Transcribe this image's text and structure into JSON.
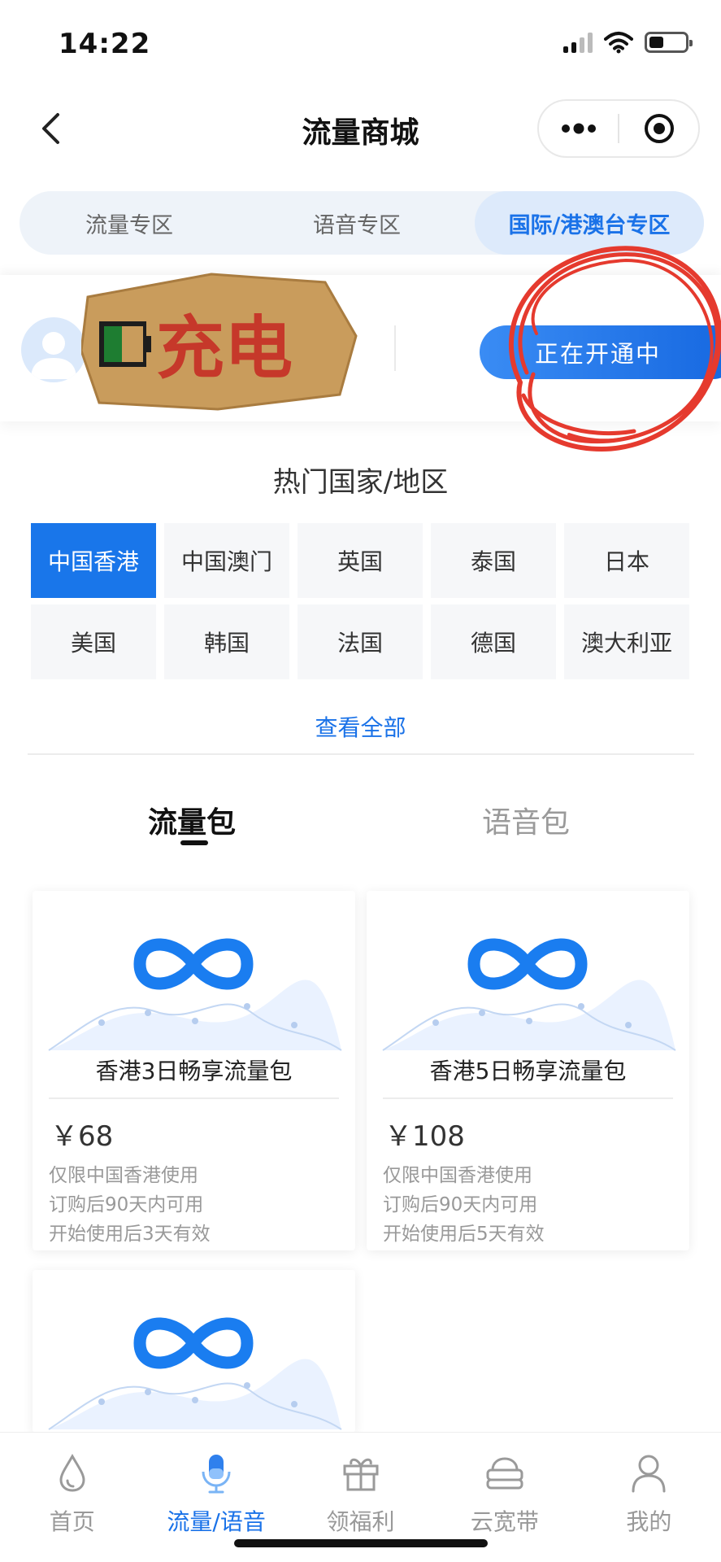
{
  "status_bar": {
    "time": "14:22"
  },
  "header": {
    "title": "流量商城"
  },
  "zone_tabs": [
    {
      "label": "流量专区",
      "active": false
    },
    {
      "label": "语音专区",
      "active": false
    },
    {
      "label": "国际/港澳台专区",
      "active": true
    }
  ],
  "user_card": {
    "sticker_text": "充电",
    "status_button": "正在开通中"
  },
  "hot_regions": {
    "title": "热门国家/地区",
    "items": [
      "中国香港",
      "中国澳门",
      "英国",
      "泰国",
      "日本",
      "美国",
      "韩国",
      "法国",
      "德国",
      "澳大利亚"
    ],
    "active_index": 0,
    "view_all": "查看全部"
  },
  "package_tabs": {
    "active": "流量包",
    "inactive": "语音包"
  },
  "products": [
    {
      "name": "香港3日畅享流量包",
      "price": "￥68",
      "desc": [
        "仅限中国香港使用",
        "订购后90天内可用",
        "开始使用后3天有效"
      ]
    },
    {
      "name": "香港5日畅享流量包",
      "price": "￥108",
      "desc": [
        "仅限中国香港使用",
        "订购后90天内可用",
        "开始使用后5天有效"
      ]
    }
  ],
  "bottom_nav": [
    {
      "label": "首页",
      "icon": "drop-icon",
      "active": false
    },
    {
      "label": "流量/语音",
      "icon": "microphone-icon",
      "active": true
    },
    {
      "label": "领福利",
      "icon": "gift-icon",
      "active": false
    },
    {
      "label": "云宽带",
      "icon": "router-icon",
      "active": false
    },
    {
      "label": "我的",
      "icon": "user-icon",
      "active": false
    }
  ],
  "colors": {
    "accent": "#1a72e8",
    "active_region": "#1976ea",
    "scribble": "#e53a2e"
  }
}
